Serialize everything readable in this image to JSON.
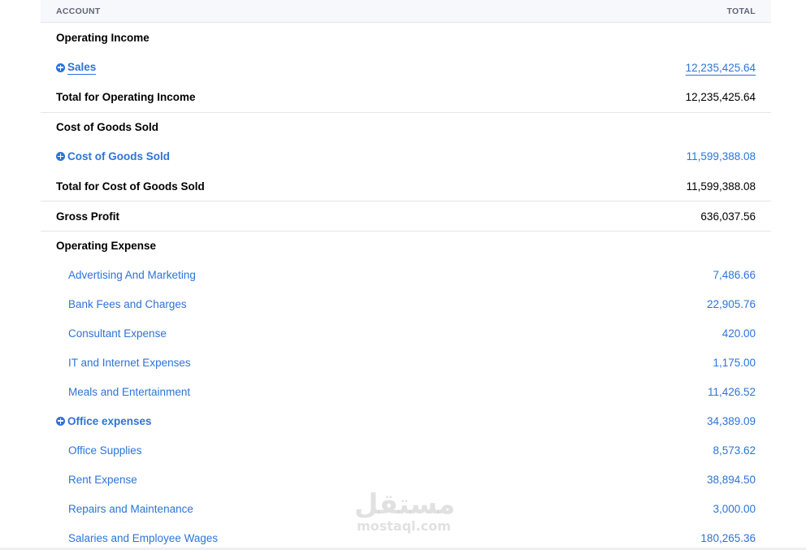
{
  "header": {
    "account": "ACCOUNT",
    "total": "TOTAL"
  },
  "rows": [
    {
      "label": "Operating Income",
      "amount": ""
    },
    {
      "label": "Sales",
      "amount": "12,235,425.64"
    },
    {
      "label": "Total for Operating Income",
      "amount": "12,235,425.64"
    },
    {
      "label": "Cost of Goods Sold",
      "amount": ""
    },
    {
      "label": "Cost of Goods Sold",
      "amount": "11,599,388.08"
    },
    {
      "label": "Total for Cost of Goods Sold",
      "amount": "11,599,388.08"
    },
    {
      "label": "Gross Profit",
      "amount": "636,037.56"
    },
    {
      "label": "Operating Expense",
      "amount": ""
    },
    {
      "label": "Advertising And Marketing",
      "amount": "7,486.66"
    },
    {
      "label": "Bank Fees and Charges",
      "amount": "22,905.76"
    },
    {
      "label": "Consultant Expense",
      "amount": "420.00"
    },
    {
      "label": "IT and Internet Expenses",
      "amount": "1,175.00"
    },
    {
      "label": "Meals and Entertainment",
      "amount": "11,426.52"
    },
    {
      "label": "Office expenses",
      "amount": "34,389.09"
    },
    {
      "label": "Office Supplies",
      "amount": "8,573.62"
    },
    {
      "label": "Rent Expense",
      "amount": "38,894.50"
    },
    {
      "label": "Repairs and Maintenance",
      "amount": "3,000.00"
    },
    {
      "label": "Salaries and Employee Wages",
      "amount": "180,265.36"
    }
  ],
  "watermark": {
    "arabic": "مستقل",
    "latin": "mostaql.com"
  },
  "colors": {
    "link": "#2c74d8",
    "header_bg": "#f7f8fb",
    "divider": "#e3e5ea"
  },
  "icons": {
    "expand": "plus-circle-icon"
  }
}
